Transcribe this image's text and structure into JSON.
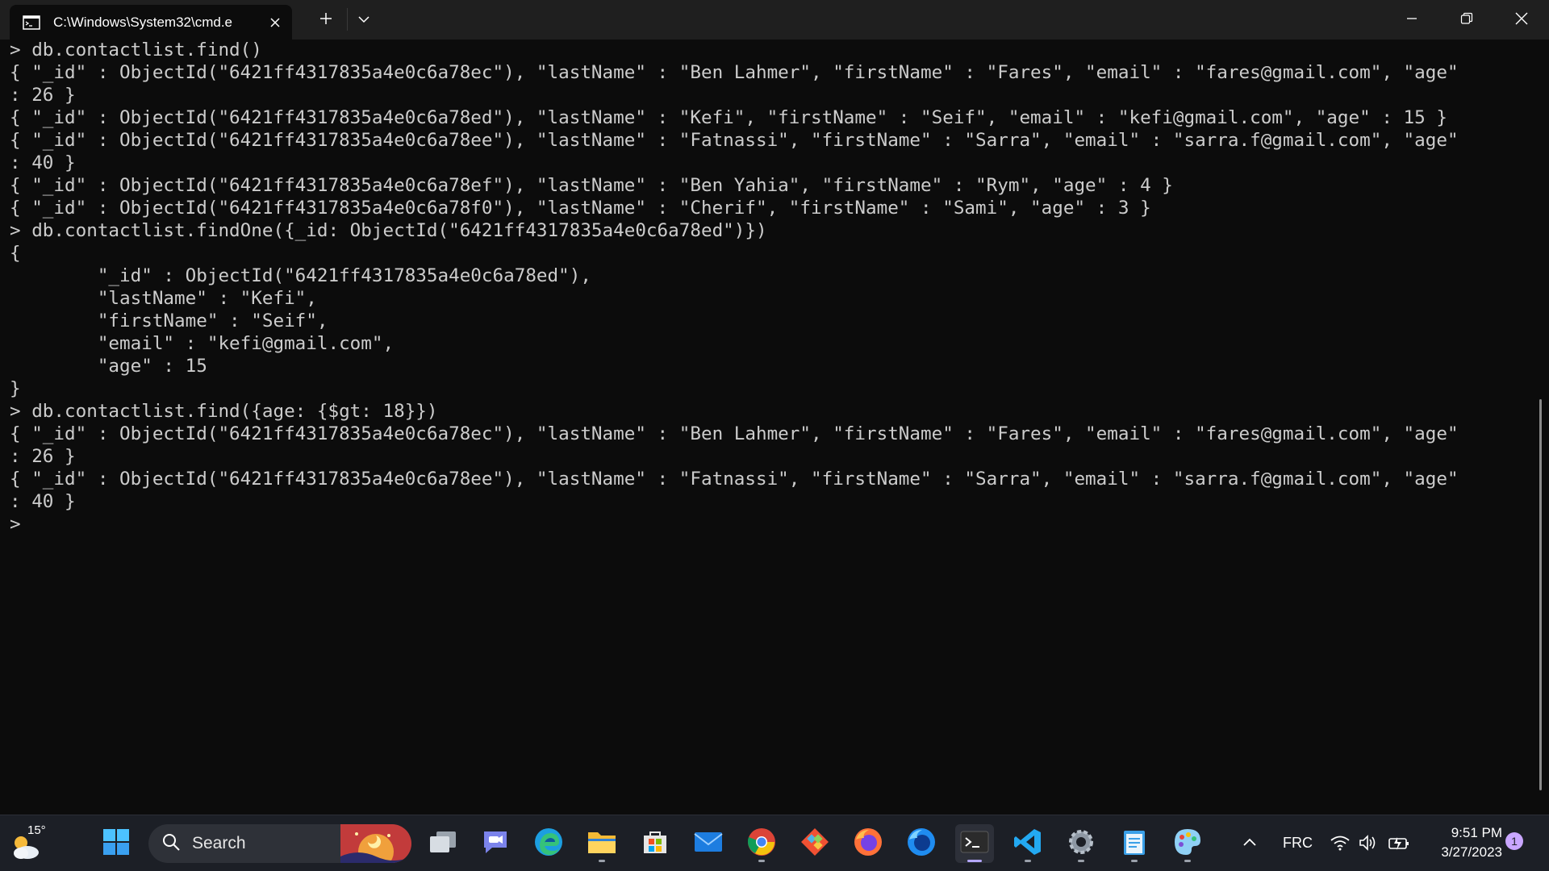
{
  "window": {
    "tab_title": "C:\\Windows\\System32\\cmd.e",
    "tab_icon": "cmd-icon",
    "new_tab_icon": "plus-icon",
    "dropdown_icon": "chevron-down-icon",
    "controls": [
      "minimize-icon",
      "restore-icon",
      "close-icon"
    ]
  },
  "terminal": {
    "lines": [
      "> db.contactlist.find()",
      "{ \"_id\" : ObjectId(\"6421ff4317835a4e0c6a78ec\"), \"lastName\" : \"Ben Lahmer\", \"firstName\" : \"Fares\", \"email\" : \"fares@gmail.com\", \"age\"",
      ": 26 }",
      "{ \"_id\" : ObjectId(\"6421ff4317835a4e0c6a78ed\"), \"lastName\" : \"Kefi\", \"firstName\" : \"Seif\", \"email\" : \"kefi@gmail.com\", \"age\" : 15 }",
      "{ \"_id\" : ObjectId(\"6421ff4317835a4e0c6a78ee\"), \"lastName\" : \"Fatnassi\", \"firstName\" : \"Sarra\", \"email\" : \"sarra.f@gmail.com\", \"age\"",
      ": 40 }",
      "{ \"_id\" : ObjectId(\"6421ff4317835a4e0c6a78ef\"), \"lastName\" : \"Ben Yahia\", \"firstName\" : \"Rym\", \"age\" : 4 }",
      "{ \"_id\" : ObjectId(\"6421ff4317835a4e0c6a78f0\"), \"lastName\" : \"Cherif\", \"firstName\" : \"Sami\", \"age\" : 3 }",
      "> db.contactlist.findOne({_id: ObjectId(\"6421ff4317835a4e0c6a78ed\")})",
      "{",
      "        \"_id\" : ObjectId(\"6421ff4317835a4e0c6a78ed\"),",
      "        \"lastName\" : \"Kefi\",",
      "        \"firstName\" : \"Seif\",",
      "        \"email\" : \"kefi@gmail.com\",",
      "        \"age\" : 15",
      "}",
      "> db.contactlist.find({age: {$gt: 18}})",
      "{ \"_id\" : ObjectId(\"6421ff4317835a4e0c6a78ec\"), \"lastName\" : \"Ben Lahmer\", \"firstName\" : \"Fares\", \"email\" : \"fares@gmail.com\", \"age\"",
      ": 26 }",
      "{ \"_id\" : ObjectId(\"6421ff4317835a4e0c6a78ee\"), \"lastName\" : \"Fatnassi\", \"firstName\" : \"Sarra\", \"email\" : \"sarra.f@gmail.com\", \"age\"",
      ": 40 }",
      ">"
    ]
  },
  "taskbar": {
    "weather_temp": "15°",
    "weather_icon": "partly-cloudy-icon",
    "start_icon": "windows-start-icon",
    "search_label": "Search",
    "apps": [
      "task-view-icon",
      "teams-chat-icon",
      "edge-icon",
      "file-explorer-icon",
      "microsoft-store-icon",
      "mail-icon",
      "chrome-icon",
      "git-icon",
      "firefox-icon",
      "firefox-developer-icon",
      "terminal-icon",
      "vscode-icon",
      "settings-icon",
      "notepad-icon",
      "paint-icon"
    ],
    "tray": {
      "language": "FRC",
      "time": "9:51 PM",
      "date": "3/27/2023",
      "notification_count": "1"
    }
  },
  "colors": {
    "terminal_bg": "#0c0c0c",
    "terminal_fg": "#cccccc",
    "titlebar_bg": "#1f1f1f",
    "taskbar_bg": "#1c1f26",
    "accent": "#b4a7ff"
  }
}
